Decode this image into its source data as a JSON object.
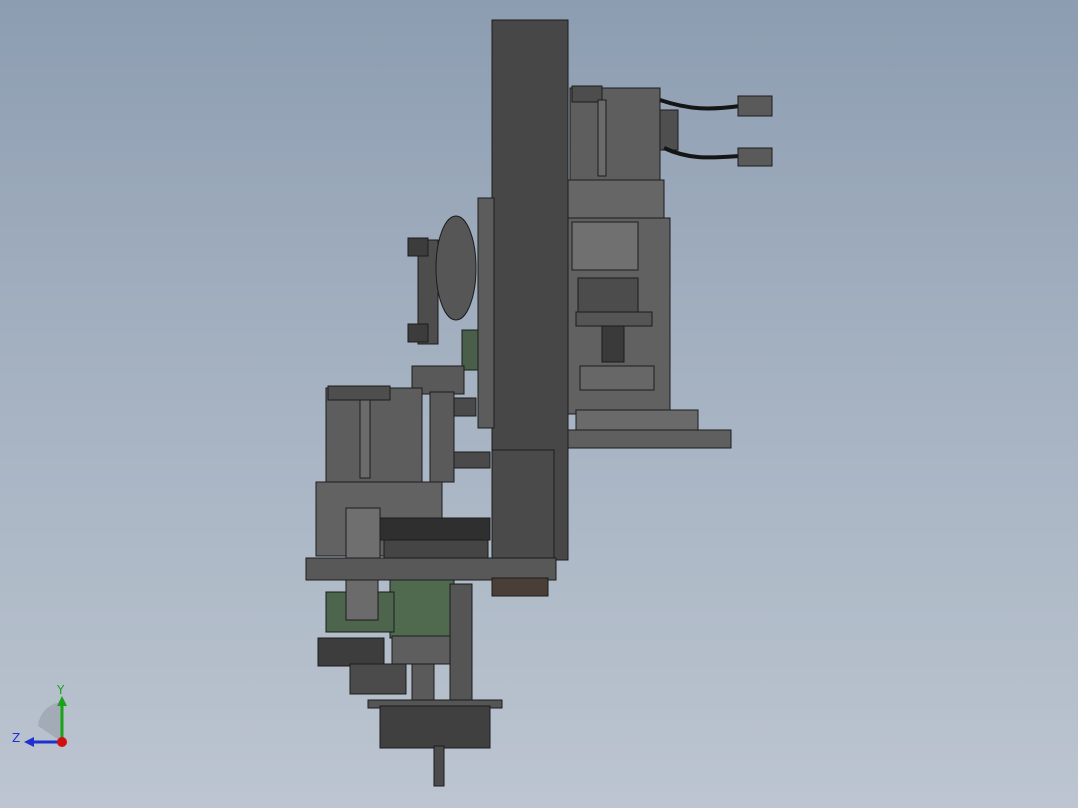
{
  "viewport": {
    "background_top": "#8d9db1",
    "background_bottom": "#bcc5d0",
    "model_body_color": "#555555",
    "model_dark_color": "#3e3e3e",
    "model_green_color": "#4f6a4f"
  },
  "triad": {
    "y_axis_label": "Y",
    "z_axis_label": "Z",
    "y_axis_color": "#1aa21a",
    "z_axis_color": "#1f2fd0",
    "x_axis_color": "#d01010"
  }
}
